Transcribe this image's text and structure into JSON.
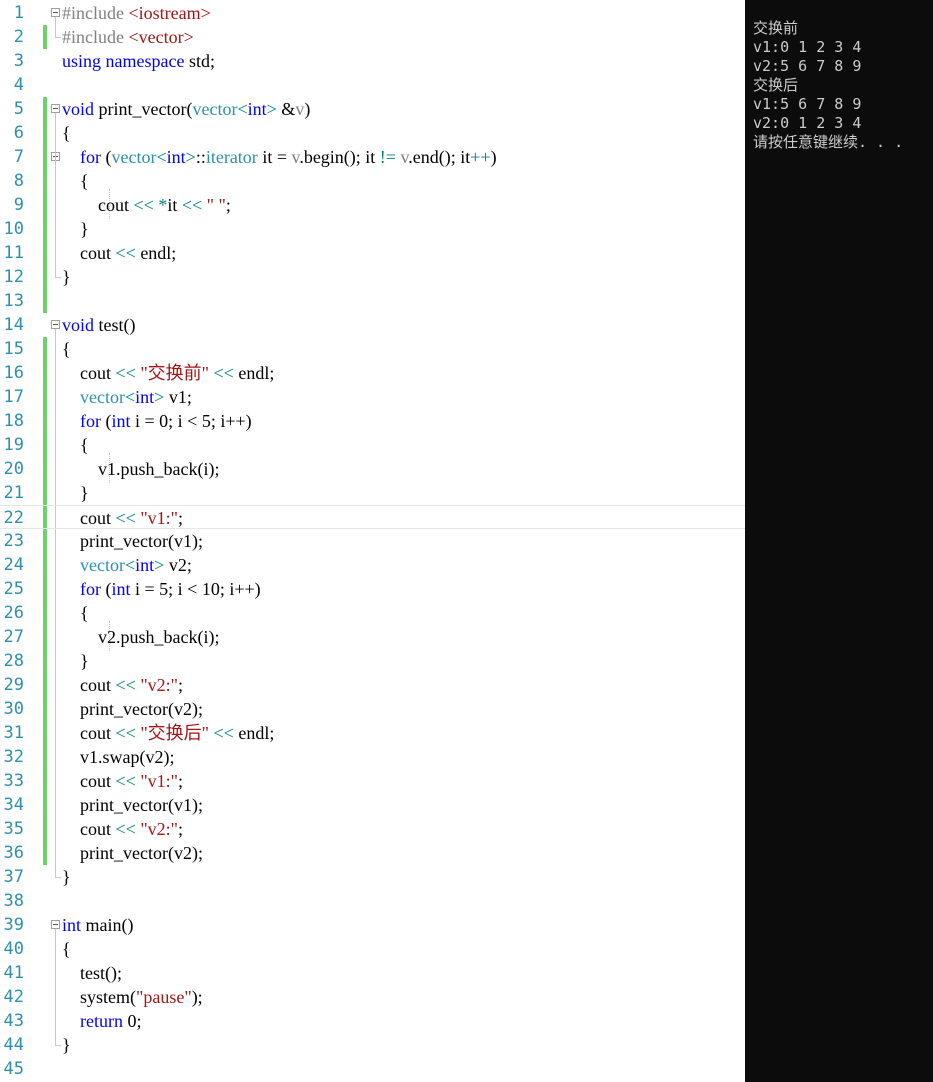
{
  "editor": {
    "lines": [
      {
        "n": "1",
        "parts": [
          {
            "t": "#include ",
            "c": "pp"
          },
          {
            "t": "<iostream>",
            "c": "str"
          }
        ]
      },
      {
        "n": "2",
        "parts": [
          {
            "t": "#include ",
            "c": "pp"
          },
          {
            "t": "<vector>",
            "c": "str"
          }
        ]
      },
      {
        "n": "3",
        "parts": [
          {
            "t": "using namespace",
            "c": "kw"
          },
          {
            "t": " std;",
            "c": ""
          }
        ]
      },
      {
        "n": "4",
        "parts": []
      },
      {
        "n": "5",
        "parts": [
          {
            "t": "void",
            "c": "kw"
          },
          {
            "t": " print_vector(",
            "c": ""
          },
          {
            "t": "vector",
            "c": "ty"
          },
          {
            "t": "<",
            "c": "op"
          },
          {
            "t": "int",
            "c": "kw"
          },
          {
            "t": ">",
            "c": "op"
          },
          {
            "t": " &",
            "c": ""
          },
          {
            "t": "v",
            "c": "par"
          },
          {
            "t": ")",
            "c": ""
          }
        ]
      },
      {
        "n": "6",
        "parts": [
          {
            "t": "{",
            "c": ""
          }
        ]
      },
      {
        "n": "7",
        "parts": [
          {
            "t": "    ",
            "c": ""
          },
          {
            "t": "for",
            "c": "kw"
          },
          {
            "t": " (",
            "c": ""
          },
          {
            "t": "vector",
            "c": "ty"
          },
          {
            "t": "<",
            "c": "op"
          },
          {
            "t": "int",
            "c": "kw"
          },
          {
            "t": ">",
            "c": "op"
          },
          {
            "t": "::",
            "c": ""
          },
          {
            "t": "iterator",
            "c": "ty"
          },
          {
            "t": " it = ",
            "c": ""
          },
          {
            "t": "v",
            "c": "par"
          },
          {
            "t": ".begin(); it ",
            "c": ""
          },
          {
            "t": "!=",
            "c": "op"
          },
          {
            "t": " ",
            "c": ""
          },
          {
            "t": "v",
            "c": "par"
          },
          {
            "t": ".end(); it",
            "c": ""
          },
          {
            "t": "++",
            "c": "op"
          },
          {
            "t": ")",
            "c": ""
          }
        ]
      },
      {
        "n": "8",
        "parts": [
          {
            "t": "    {",
            "c": ""
          }
        ]
      },
      {
        "n": "9",
        "parts": [
          {
            "t": "        cout ",
            "c": ""
          },
          {
            "t": "<<",
            "c": "op"
          },
          {
            "t": " ",
            "c": ""
          },
          {
            "t": "*",
            "c": "op"
          },
          {
            "t": "it ",
            "c": ""
          },
          {
            "t": "<<",
            "c": "op"
          },
          {
            "t": " ",
            "c": ""
          },
          {
            "t": "\" \"",
            "c": "str"
          },
          {
            "t": ";",
            "c": ""
          }
        ]
      },
      {
        "n": "10",
        "parts": [
          {
            "t": "    }",
            "c": ""
          }
        ]
      },
      {
        "n": "11",
        "parts": [
          {
            "t": "    cout ",
            "c": ""
          },
          {
            "t": "<<",
            "c": "op"
          },
          {
            "t": " endl;",
            "c": ""
          }
        ]
      },
      {
        "n": "12",
        "parts": [
          {
            "t": "}",
            "c": ""
          }
        ]
      },
      {
        "n": "13",
        "parts": []
      },
      {
        "n": "14",
        "parts": [
          {
            "t": "void",
            "c": "kw"
          },
          {
            "t": " test()",
            "c": ""
          }
        ]
      },
      {
        "n": "15",
        "parts": [
          {
            "t": "{",
            "c": ""
          }
        ]
      },
      {
        "n": "16",
        "parts": [
          {
            "t": "    cout ",
            "c": ""
          },
          {
            "t": "<<",
            "c": "op"
          },
          {
            "t": " ",
            "c": ""
          },
          {
            "t": "\"交换前\"",
            "c": "str"
          },
          {
            "t": " ",
            "c": ""
          },
          {
            "t": "<<",
            "c": "op"
          },
          {
            "t": " endl;",
            "c": ""
          }
        ]
      },
      {
        "n": "17",
        "parts": [
          {
            "t": "    ",
            "c": ""
          },
          {
            "t": "vector",
            "c": "ty"
          },
          {
            "t": "<",
            "c": "op"
          },
          {
            "t": "int",
            "c": "kw"
          },
          {
            "t": ">",
            "c": "op"
          },
          {
            "t": " v1;",
            "c": ""
          }
        ]
      },
      {
        "n": "18",
        "parts": [
          {
            "t": "    ",
            "c": ""
          },
          {
            "t": "for",
            "c": "kw"
          },
          {
            "t": " (",
            "c": ""
          },
          {
            "t": "int",
            "c": "kw"
          },
          {
            "t": " i = 0; i < 5; i++)",
            "c": ""
          }
        ]
      },
      {
        "n": "19",
        "parts": [
          {
            "t": "    {",
            "c": ""
          }
        ]
      },
      {
        "n": "20",
        "parts": [
          {
            "t": "        v1.push_back(i);",
            "c": ""
          }
        ]
      },
      {
        "n": "21",
        "parts": [
          {
            "t": "    }",
            "c": ""
          }
        ]
      },
      {
        "n": "22",
        "parts": [
          {
            "t": "    cout ",
            "c": ""
          },
          {
            "t": "<<",
            "c": "op"
          },
          {
            "t": " ",
            "c": ""
          },
          {
            "t": "\"v1:\"",
            "c": "str"
          },
          {
            "t": ";",
            "c": ""
          }
        ]
      },
      {
        "n": "23",
        "parts": [
          {
            "t": "    print_vector(v1);",
            "c": ""
          }
        ]
      },
      {
        "n": "24",
        "parts": [
          {
            "t": "    ",
            "c": ""
          },
          {
            "t": "vector",
            "c": "ty"
          },
          {
            "t": "<",
            "c": "op"
          },
          {
            "t": "int",
            "c": "kw"
          },
          {
            "t": ">",
            "c": "op"
          },
          {
            "t": " v2;",
            "c": ""
          }
        ]
      },
      {
        "n": "25",
        "parts": [
          {
            "t": "    ",
            "c": ""
          },
          {
            "t": "for",
            "c": "kw"
          },
          {
            "t": " (",
            "c": ""
          },
          {
            "t": "int",
            "c": "kw"
          },
          {
            "t": " i = 5; i < 10; i++)",
            "c": ""
          }
        ]
      },
      {
        "n": "26",
        "parts": [
          {
            "t": "    {",
            "c": ""
          }
        ]
      },
      {
        "n": "27",
        "parts": [
          {
            "t": "        v2.push_back(i);",
            "c": ""
          }
        ]
      },
      {
        "n": "28",
        "parts": [
          {
            "t": "    }",
            "c": ""
          }
        ]
      },
      {
        "n": "29",
        "parts": [
          {
            "t": "    cout ",
            "c": ""
          },
          {
            "t": "<<",
            "c": "op"
          },
          {
            "t": " ",
            "c": ""
          },
          {
            "t": "\"v2:\"",
            "c": "str"
          },
          {
            "t": ";",
            "c": ""
          }
        ]
      },
      {
        "n": "30",
        "parts": [
          {
            "t": "    print_vector(v2);",
            "c": ""
          }
        ]
      },
      {
        "n": "31",
        "parts": [
          {
            "t": "    cout ",
            "c": ""
          },
          {
            "t": "<<",
            "c": "op"
          },
          {
            "t": " ",
            "c": ""
          },
          {
            "t": "\"交换后\"",
            "c": "str"
          },
          {
            "t": " ",
            "c": ""
          },
          {
            "t": "<<",
            "c": "op"
          },
          {
            "t": " endl;",
            "c": ""
          }
        ]
      },
      {
        "n": "32",
        "parts": [
          {
            "t": "    v1.swap(v2);",
            "c": ""
          }
        ]
      },
      {
        "n": "33",
        "parts": [
          {
            "t": "    cout ",
            "c": ""
          },
          {
            "t": "<<",
            "c": "op"
          },
          {
            "t": " ",
            "c": ""
          },
          {
            "t": "\"v1:\"",
            "c": "str"
          },
          {
            "t": ";",
            "c": ""
          }
        ]
      },
      {
        "n": "34",
        "parts": [
          {
            "t": "    print_vector(v1);",
            "c": ""
          }
        ]
      },
      {
        "n": "35",
        "parts": [
          {
            "t": "    cout ",
            "c": ""
          },
          {
            "t": "<<",
            "c": "op"
          },
          {
            "t": " ",
            "c": ""
          },
          {
            "t": "\"v2:\"",
            "c": "str"
          },
          {
            "t": ";",
            "c": ""
          }
        ]
      },
      {
        "n": "36",
        "parts": [
          {
            "t": "    print_vector(v2);",
            "c": ""
          }
        ]
      },
      {
        "n": "37",
        "parts": [
          {
            "t": "}",
            "c": ""
          }
        ]
      },
      {
        "n": "38",
        "parts": []
      },
      {
        "n": "39",
        "parts": [
          {
            "t": "int",
            "c": "kw"
          },
          {
            "t": " main()",
            "c": ""
          }
        ]
      },
      {
        "n": "40",
        "parts": [
          {
            "t": "{",
            "c": ""
          }
        ]
      },
      {
        "n": "41",
        "parts": [
          {
            "t": "    test();",
            "c": ""
          }
        ]
      },
      {
        "n": "42",
        "parts": [
          {
            "t": "    system(",
            "c": ""
          },
          {
            "t": "\"pause\"",
            "c": "str"
          },
          {
            "t": ");",
            "c": ""
          }
        ]
      },
      {
        "n": "43",
        "parts": [
          {
            "t": "    ",
            "c": ""
          },
          {
            "t": "return",
            "c": "kw"
          },
          {
            "t": " 0;",
            "c": ""
          }
        ]
      },
      {
        "n": "44",
        "parts": [
          {
            "t": "}",
            "c": ""
          }
        ]
      },
      {
        "n": "45",
        "parts": []
      }
    ],
    "current_line": "22",
    "fold_lines": [
      "1",
      "5",
      "7",
      "14",
      "39"
    ],
    "colors": {
      "keyword": "#0000ff",
      "type": "#2b91af",
      "string": "#a31515",
      "operator": "#008080",
      "preprocessor": "#808080",
      "line_number": "#2b91af",
      "change_bar": "#6ad46a"
    }
  },
  "console": {
    "lines": [
      "交换前",
      "v1:0 1 2 3 4",
      "v2:5 6 7 8 9",
      "交换后",
      "v1:5 6 7 8 9",
      "v2:0 1 2 3 4",
      "请按任意键继续. . ."
    ],
    "background": "#0c0c0c",
    "foreground": "#cccccc"
  }
}
